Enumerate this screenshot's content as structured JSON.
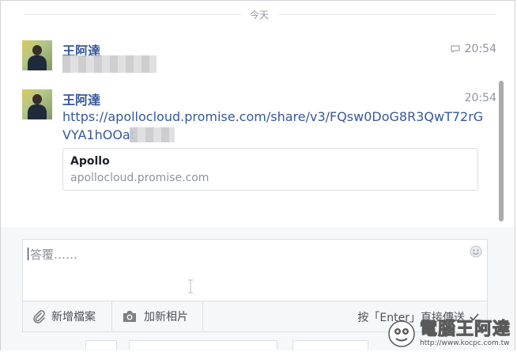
{
  "day_divider": "今天",
  "messages": [
    {
      "sender": "王阿達",
      "time": "20:54"
    },
    {
      "sender": "王阿達",
      "time": "20:54",
      "link_line1": "https://apollocloud.promise.com/share/v3/FQsw0DoG8R3QwT72rG",
      "link_line2": "VYA1hOOat",
      "preview": {
        "title": "Apollo",
        "url": "apollocloud.promise.com"
      }
    }
  ],
  "composer": {
    "placeholder": "答覆……",
    "add_file": "新增檔案",
    "add_photo": "加新相片",
    "enter_hint": "按「Enter」直接傳送"
  },
  "watermark": {
    "main": "電腦王阿達",
    "url": "http://www.kocpc.com.tw"
  },
  "colors": {
    "link": "#365899",
    "muted": "#90949c",
    "border": "#dddfe2",
    "panel": "#f6f7f9"
  }
}
